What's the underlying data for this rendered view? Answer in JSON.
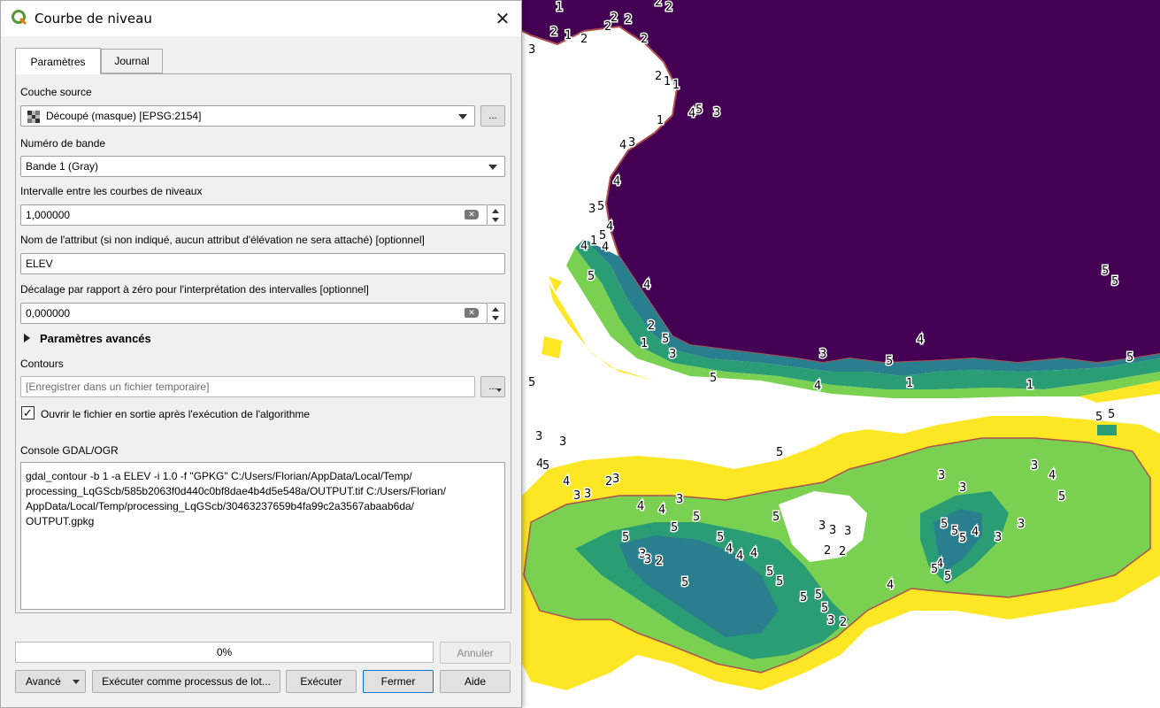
{
  "window": {
    "title": "Courbe de niveau",
    "close_glyph": "✕"
  },
  "tabs": [
    {
      "label": "Paramètres",
      "active": true
    },
    {
      "label": "Journal",
      "active": false
    }
  ],
  "form": {
    "source_label": "Couche source",
    "source_value": "Découpé (masque) [EPSG:2154]",
    "band_label": "Numéro de bande",
    "band_value": "Bande 1 (Gray)",
    "interval_label": "Intervalle entre les courbes de niveaux",
    "interval_value": "1,000000",
    "attr_label": "Nom de l'attribut (si non indiqué, aucun attribut d'élévation ne sera attaché) [optionnel]",
    "attr_value": "ELEV",
    "offset_label": "Décalage par rapport à zéro pour l'interprétation des intervalles [optionnel]",
    "offset_value": "0,000000",
    "advanced_label": "Paramètres avancés",
    "contours_label": "Contours",
    "contours_placeholder": "[Enregistrer dans un fichier temporaire]",
    "open_output_label": "Ouvrir le fichier en sortie après l'exécution de l'algorithme",
    "open_output_checked": true,
    "browse_label": "...",
    "console_label": "Console GDAL/OGR",
    "console_text": "gdal_contour -b 1 -a ELEV -i 1.0 -f \"GPKG\" C:/Users/Florian/AppData/Local/Temp/\nprocessing_LqGScb/585b2063f0d440c0bf8dae4b4d5e548a/OUTPUT.tif C:/Users/Florian/\nAppData/Local/Temp/processing_LqGScb/30463237659b4fa99c2a3567abaab6da/\nOUTPUT.gpkg"
  },
  "progress": {
    "percent": 0,
    "text": "0%"
  },
  "buttons": {
    "cancel": "Annuler",
    "advanced": "Avancé",
    "batch": "Exécuter comme processus de lot...",
    "run": "Exécuter",
    "close": "Fermer",
    "help": "Aide"
  },
  "map": {
    "colors": {
      "deep": "#440154",
      "teal": "#2a7f8e",
      "green": "#2a9d74",
      "lightgreen": "#7ad151",
      "yellow": "#fde725",
      "outline": "#b05050"
    },
    "contour_labels": [
      "1",
      "2",
      "2",
      "2",
      "2",
      "1",
      "2",
      "2",
      "3",
      "2",
      "2",
      "2",
      "1",
      "1",
      "1",
      "4",
      "5",
      "3",
      "4",
      "3",
      "4",
      "3",
      "5",
      "4",
      "5",
      "1",
      "4",
      "4",
      "5",
      "4",
      "2",
      "5",
      "1",
      "3",
      "3",
      "5",
      "4",
      "5",
      "1",
      "1",
      "5",
      "5",
      "5",
      "5",
      "4",
      "5",
      "5",
      "5",
      "3",
      "3",
      "4",
      "5",
      "4",
      "3",
      "2",
      "3",
      "3",
      "4",
      "4",
      "3",
      "5",
      "5",
      "5",
      "4",
      "4",
      "4",
      "5",
      "5",
      "5",
      "5",
      "5",
      "5",
      "3",
      "2",
      "3",
      "3",
      "3",
      "2",
      "2",
      "5",
      "5",
      "5",
      "4",
      "3",
      "3",
      "3",
      "4",
      "5",
      "3",
      "3",
      "4",
      "5",
      "5",
      "4",
      "5",
      "3",
      "3",
      "2",
      "5"
    ]
  }
}
